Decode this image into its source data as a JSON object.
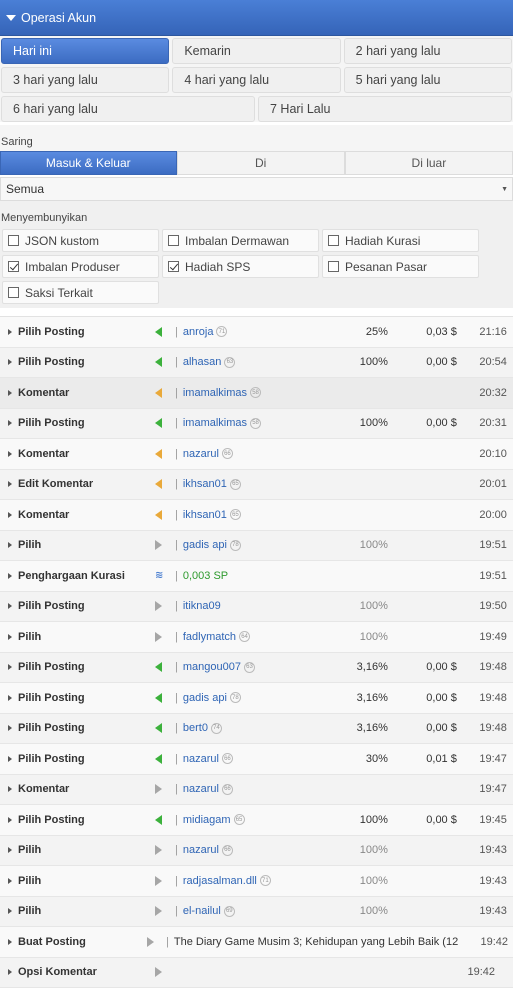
{
  "header": {
    "title": "Operasi Akun"
  },
  "days": [
    [
      {
        "label": "Hari ini",
        "active": true
      },
      {
        "label": "Kemarin"
      },
      {
        "label": "2 hari yang lalu"
      }
    ],
    [
      {
        "label": "3 hari yang lalu"
      },
      {
        "label": "4 hari yang lalu"
      },
      {
        "label": "5 hari yang lalu"
      }
    ],
    [
      {
        "label": "6 hari yang lalu"
      },
      {
        "label": "7 Hari Lalu"
      }
    ]
  ],
  "filter": {
    "label": "Saring",
    "tabs": [
      {
        "label": "Masuk & Keluar",
        "active": true
      },
      {
        "label": "Di"
      },
      {
        "label": "Di luar"
      }
    ],
    "select_value": "Semua"
  },
  "hide": {
    "label": "Menyembunyikan",
    "options": [
      {
        "label": "JSON kustom",
        "checked": false
      },
      {
        "label": "Imbalan Dermawan",
        "checked": false
      },
      {
        "label": "Hadiah Kurasi",
        "checked": false
      },
      {
        "label": "Imbalan Produser",
        "checked": true
      },
      {
        "label": "Hadiah SPS",
        "checked": true
      },
      {
        "label": "Pesanan Pasar",
        "checked": false
      },
      {
        "label": "Saksi Terkait",
        "checked": false
      }
    ]
  },
  "operations": [
    {
      "type": "Pilih Posting",
      "icon": "in-green",
      "user": "anroja",
      "rep": "71",
      "pct": "25%",
      "usd": "0,03 $",
      "time": "21:16"
    },
    {
      "type": "Pilih Posting",
      "icon": "in-green",
      "user": "alhasan",
      "rep": "63",
      "pct": "100%",
      "usd": "0,00 $",
      "time": "20:54"
    },
    {
      "type": "Komentar",
      "icon": "in-orange",
      "user": "imamalkimas",
      "rep": "58",
      "pct": "",
      "usd": "",
      "time": "20:32",
      "hl": true
    },
    {
      "type": "Pilih Posting",
      "icon": "in-green",
      "user": "imamalkimas",
      "rep": "58",
      "pct": "100%",
      "usd": "0,00 $",
      "time": "20:31"
    },
    {
      "type": "Komentar",
      "icon": "in-orange",
      "user": "nazarul",
      "rep": "66",
      "pct": "",
      "usd": "",
      "time": "20:10"
    },
    {
      "type": "Edit Komentar",
      "icon": "in-orange",
      "user": "ikhsan01",
      "rep": "65",
      "pct": "",
      "usd": "",
      "time": "20:01"
    },
    {
      "type": "Komentar",
      "icon": "in-orange",
      "user": "ikhsan01",
      "rep": "65",
      "pct": "",
      "usd": "",
      "time": "20:00"
    },
    {
      "type": "Pilih",
      "icon": "out-grey",
      "user": "gadis api",
      "rep": "78",
      "pct": "100%",
      "pct_grey": true,
      "usd": "",
      "time": "19:51"
    },
    {
      "type": "Penghargaan Kurasi",
      "icon": "steem",
      "user": "0,003 SP",
      "user_green": true,
      "rep": "",
      "pct": "",
      "usd": "",
      "time": "19:51"
    },
    {
      "type": "Pilih Posting",
      "icon": "out-grey",
      "user": "itikna09",
      "rep": "",
      "pct": "100%",
      "pct_grey": true,
      "usd": "",
      "time": "19:50"
    },
    {
      "type": "Pilih",
      "icon": "out-grey",
      "user": "fadlymatch",
      "rep": "64",
      "pct": "100%",
      "pct_grey": true,
      "usd": "",
      "time": "19:49"
    },
    {
      "type": "Pilih Posting",
      "icon": "in-green",
      "user": "mangou007",
      "rep": "63",
      "pct": "3,16%",
      "usd": "0,00 $",
      "time": "19:48"
    },
    {
      "type": "Pilih Posting",
      "icon": "in-green",
      "user": "gadis api",
      "rep": "78",
      "pct": "3,16%",
      "usd": "0,00 $",
      "time": "19:48"
    },
    {
      "type": "Pilih Posting",
      "icon": "in-green",
      "user": "bert0",
      "rep": "74",
      "pct": "3,16%",
      "usd": "0,00 $",
      "time": "19:48"
    },
    {
      "type": "Pilih Posting",
      "icon": "in-green",
      "user": "nazarul",
      "rep": "66",
      "pct": "30%",
      "usd": "0,01 $",
      "time": "19:47"
    },
    {
      "type": "Komentar",
      "icon": "out-grey",
      "user": "nazarul",
      "rep": "66",
      "pct": "",
      "usd": "",
      "time": "19:47"
    },
    {
      "type": "Pilih Posting",
      "icon": "in-green",
      "user": "midiagam",
      "rep": "65",
      "pct": "100%",
      "usd": "0,00 $",
      "time": "19:45"
    },
    {
      "type": "Pilih",
      "icon": "out-grey",
      "user": "nazarul",
      "rep": "66",
      "pct": "100%",
      "pct_grey": true,
      "usd": "",
      "time": "19:43"
    },
    {
      "type": "Pilih",
      "icon": "out-grey",
      "user": "radjasalman.dll",
      "rep": "71",
      "pct": "100%",
      "pct_grey": true,
      "usd": "",
      "time": "19:43"
    },
    {
      "type": "Pilih",
      "icon": "out-grey",
      "user": "el-nailul",
      "rep": "69",
      "pct": "100%",
      "pct_grey": true,
      "usd": "",
      "time": "19:43"
    },
    {
      "type": "Buat Posting",
      "icon": "out-grey",
      "user": "The Diary Game Musim 3; Kehidupan yang Lebih Baik (12 ...",
      "user_plain": true,
      "rep": "",
      "pct": "",
      "usd": "",
      "time": "19:42"
    },
    {
      "type": "Opsi Komentar",
      "icon": "out-grey",
      "user": "",
      "rep": "",
      "pct": "",
      "usd": "",
      "time": "19:42"
    }
  ]
}
